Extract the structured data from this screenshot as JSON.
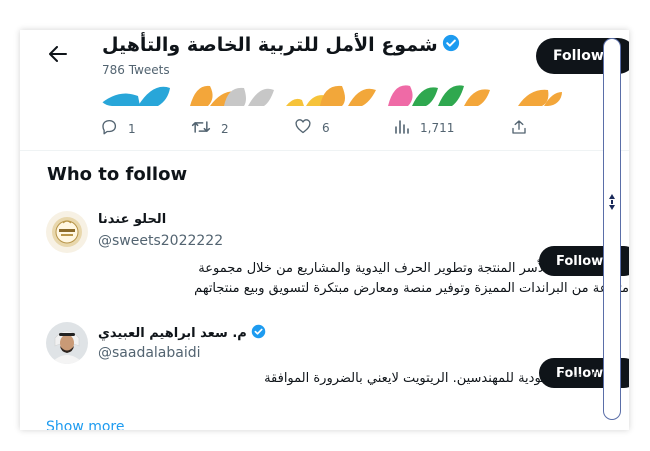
{
  "header": {
    "title": "شموع الأمل للتربية الخاصة والتأهيل",
    "tweet_count": "786 Tweets",
    "follow_label": "Follow"
  },
  "actions": {
    "replies": "1",
    "retweets": "2",
    "likes": "6",
    "views": "1,711"
  },
  "who_to_follow": {
    "title": "Who to follow",
    "users": [
      {
        "name": "الحلو عندنا",
        "handle": "@sweets2022222",
        "verified": false,
        "bio_line1": "رؤيتنا هي دعم الأسر المنتجة وتطوير الحرف اليدوية والمشاريع  من خلال مجموعة",
        "bio_line2": "متنوعة من البراندات المميزة وتوفير منصة ومعارض مبتكرة لتسويق وبيع منتجاتهم",
        "follow_label": "Follow"
      },
      {
        "name": "م. سعد ابراهيم العبيدي",
        "handle": "@saadalabaidi",
        "verified": true,
        "bio_line1": "عضو الهيئة السعودية للمهندسين. الريتويت لايعني بالضرورة الموافقة",
        "follow_label": "Follow"
      }
    ],
    "show_more": "Show more"
  },
  "colors": {
    "accent": "#1d9bf0",
    "text": "#0f1419",
    "muted": "#536471",
    "button_bg": "#0f1419"
  }
}
